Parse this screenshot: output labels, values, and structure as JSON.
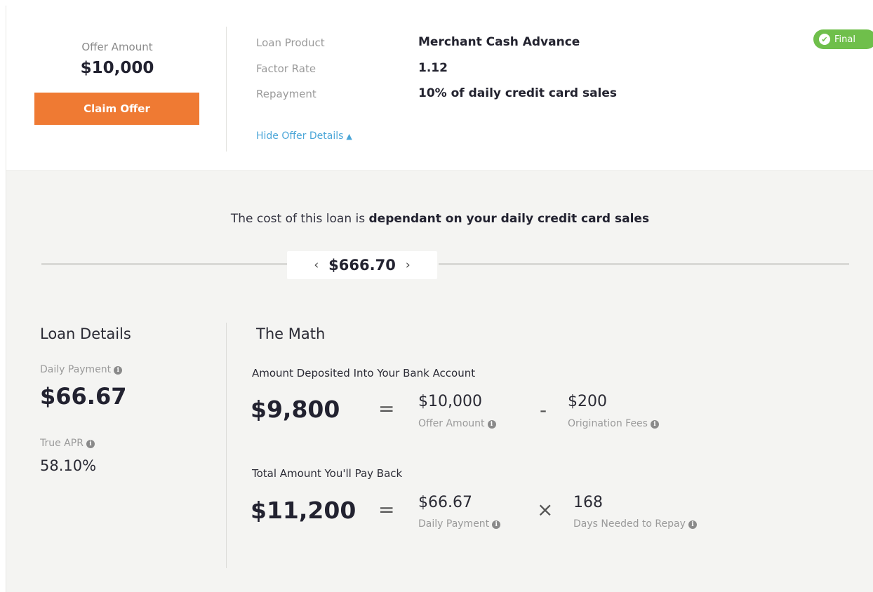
{
  "offer": {
    "amount_label": "Offer Amount",
    "amount": "$10,000",
    "claim_label": "Claim Offer"
  },
  "details": {
    "items": [
      {
        "label": "Loan Product",
        "value": "Merchant Cash Advance"
      },
      {
        "label": "Factor Rate",
        "value": "1.12"
      },
      {
        "label": "Repayment",
        "value": "10% of daily credit card sales"
      }
    ],
    "hide_link": "Hide Offer Details"
  },
  "badge": {
    "label": "Final"
  },
  "cost_note": {
    "prefix": "The cost of this loan is ",
    "bold": "dependant on your daily credit card sales"
  },
  "selector": {
    "value": "$666.70"
  },
  "loan_details": {
    "title": "Loan Details",
    "daily_payment_label": "Daily Payment",
    "daily_payment": "$66.67",
    "apr_label": "True APR",
    "apr": "58.10%"
  },
  "math": {
    "title": "The Math",
    "deposit": {
      "label": "Amount Deposited Into Your Bank Account",
      "total": "$9,800",
      "op1": "=",
      "term1_value": "$10,000",
      "term1_label": "Offer Amount",
      "op2": "-",
      "term2_value": "$200",
      "term2_label": "Origination Fees"
    },
    "payback": {
      "label": "Total Amount You'll Pay Back",
      "total": "$11,200",
      "op1": "=",
      "term1_value": "$66.67",
      "term1_label": "Daily Payment",
      "op2": "×",
      "term2_value": "168",
      "term2_label": "Days Needed to Repay"
    }
  },
  "colors": {
    "accent": "#ef7a33",
    "link": "#4ba6d8",
    "success": "#6fbf4b",
    "panel_bg": "#f4f4f2"
  }
}
